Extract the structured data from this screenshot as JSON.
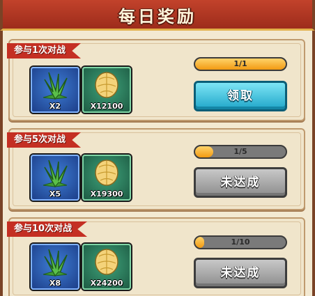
{
  "header": {
    "title": "每日奖励"
  },
  "tasks": [
    {
      "ribbon": "参与1次对战",
      "items": [
        {
          "icon": "green-spiky-plant-icon",
          "count": "X2"
        },
        {
          "icon": "golden-seed-icon",
          "count": "X12100"
        }
      ],
      "progress_text": "1/1",
      "progress_fraction": 1.0,
      "button": "领取",
      "button_state": "claimable"
    },
    {
      "ribbon": "参与5次对战",
      "items": [
        {
          "icon": "green-spiky-plant-icon",
          "count": "X5"
        },
        {
          "icon": "golden-seed-icon",
          "count": "X19300"
        }
      ],
      "progress_text": "1/5",
      "progress_fraction": 0.2,
      "button": "未达成",
      "button_state": "locked"
    },
    {
      "ribbon": "参与10次对战",
      "items": [
        {
          "icon": "green-spiky-plant-icon",
          "count": "X8"
        },
        {
          "icon": "golden-seed-icon",
          "count": "X24200"
        }
      ],
      "progress_text": "1/10",
      "progress_fraction": 0.1,
      "button": "未达成",
      "button_state": "locked"
    }
  ],
  "colors": {
    "accent_red": "#c42f23",
    "progress_fill": "#f29a12",
    "claim_button": "#1fa6c9",
    "locked_button": "#8d8d8d"
  }
}
